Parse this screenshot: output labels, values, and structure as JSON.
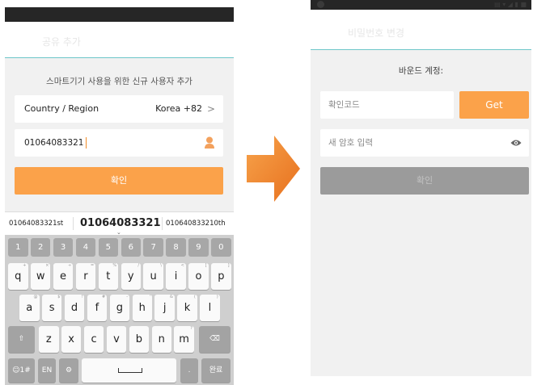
{
  "left_screen": {
    "title": "공유 추가",
    "caption": "스마트기기 사용을 위한 신규 사용자 추가",
    "region_label": "Country / Region",
    "region_value": "Korea +82",
    "region_chevron": ">",
    "phone_value": "01064083321",
    "confirm_label": "확인",
    "icons": {
      "region_chevron": "chevron-right-icon",
      "contact": "contact-person-icon"
    },
    "suggestions": [
      "01064083321st",
      "01064083321",
      "010640833210th"
    ],
    "keyboard": {
      "number_row": [
        "1",
        "2",
        "3",
        "4",
        "5",
        "6",
        "7",
        "8",
        "9",
        "0"
      ],
      "row1": [
        {
          "k": "q",
          "s": "+"
        },
        {
          "k": "w",
          "s": "×"
        },
        {
          "k": "e",
          "s": "÷"
        },
        {
          "k": "r",
          "s": "="
        },
        {
          "k": "t",
          "s": "%"
        },
        {
          "k": "y",
          "s": "/"
        },
        {
          "k": "u",
          "s": "\\"
        },
        {
          "k": "i",
          "s": "<"
        },
        {
          "k": "o",
          "s": "["
        },
        {
          "k": "p",
          "s": "]"
        }
      ],
      "row2": [
        {
          "k": "a",
          "s": "@"
        },
        {
          "k": "s",
          "s": "$"
        },
        {
          "k": "d",
          "s": "!"
        },
        {
          "k": "f",
          "s": "#"
        },
        {
          "k": "g",
          "s": "-"
        },
        {
          "k": "h",
          "s": "'"
        },
        {
          "k": "j",
          "s": "&"
        },
        {
          "k": "k",
          "s": "("
        },
        {
          "k": "l",
          "s": ")"
        }
      ],
      "row3": [
        {
          "k": "z",
          "s": ""
        },
        {
          "k": "x",
          "s": ""
        },
        {
          "k": "c",
          "s": ""
        },
        {
          "k": "v",
          "s": ""
        },
        {
          "k": "b",
          "s": ""
        },
        {
          "k": "n",
          "s": ""
        },
        {
          "k": "m",
          "s": "?"
        }
      ],
      "shift": "⇧",
      "backspace": "⌫",
      "emoji_key": "☺1#",
      "lang_key": "EN",
      "settings_key": "⚙",
      "period": ".",
      "done": "완료"
    },
    "colors": {
      "accent": "#fba24a",
      "divider": "#6ec7c9"
    }
  },
  "right_screen": {
    "title": "비밀번호 변경",
    "caption": "바운드 계정:",
    "code_placeholder": "확인코드",
    "get_label": "Get",
    "password_placeholder": "새 암호 입력",
    "confirm_label": "확인",
    "icons": {
      "visibility": "eye-icon"
    },
    "colors": {
      "accent": "#fba24a",
      "disabled": "#9b9b9b"
    }
  },
  "flow_arrow_icon": "arrow-right-icon"
}
